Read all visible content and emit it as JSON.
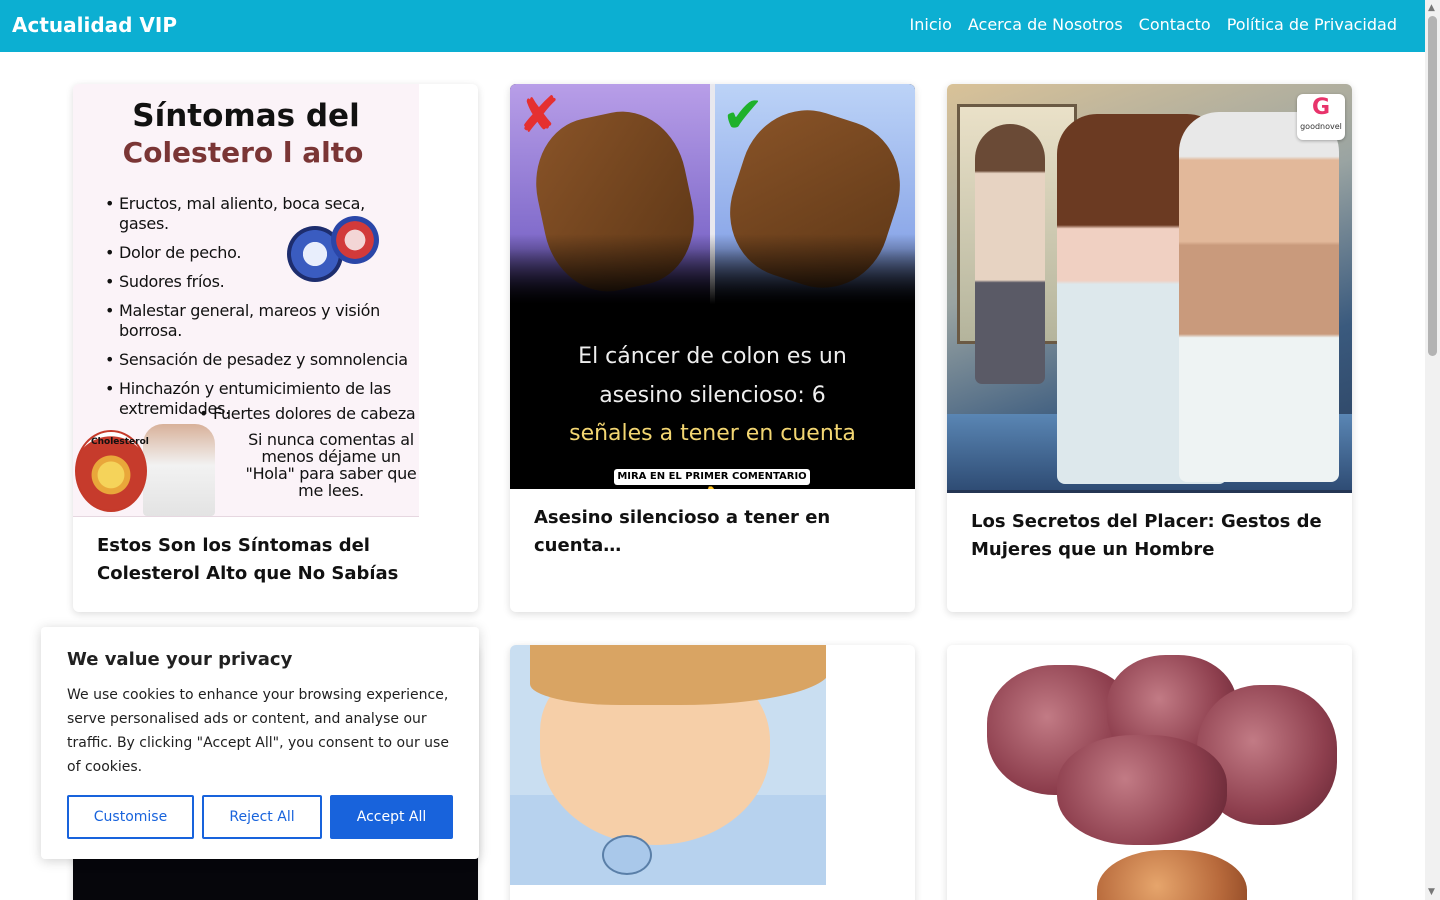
{
  "header": {
    "brand": "Actualidad VIP",
    "nav": [
      "Inicio",
      "Acerca de Nosotros",
      "Contacto",
      "Política de Privacidad"
    ]
  },
  "articles": [
    {
      "title": "Estos Son los Síntomas del Colesterol Alto que No Sabías",
      "image": {
        "heading1": "Síntomas del",
        "heading2": "Colestero l alto",
        "bullets": [
          "Eructos, mal aliento, boca seca, gases.",
          "Dolor de pecho.",
          "Sudores fríos.",
          "Malestar general, mareos y visión borrosa.",
          "Sensación de pesadez y somnolencia",
          "Hinchazón y entumicimiento de las extremidades."
        ],
        "last_bullet": "Fuertes dolores de cabeza",
        "note": "Si nunca comentas al menos déjame un \"Hola\" para saber que me lees.",
        "badge": "Cholesterol"
      }
    },
    {
      "title": "Asesino silencioso a tener en cuenta…",
      "image": {
        "line1": "El cáncer de colon es un",
        "line2": "asesino silencioso: 6",
        "line3": "señales a tener en cuenta",
        "tag": "MIRA EN EL PRIMER COMENTARIO👇"
      }
    },
    {
      "title": "Los Secretos del Placer: Gestos de Mujeres que un Hombre",
      "image": {
        "logo_text": "goodnovel"
      }
    }
  ],
  "cookie_banner": {
    "title": "We value your privacy",
    "text": "We use cookies to enhance your browsing experience, serve personalised ads or content, and analyse our traffic. By clicking \"Accept All\", you consent to our use of cookies.",
    "customise": "Customise",
    "reject": "Reject All",
    "accept": "Accept All"
  },
  "colors": {
    "header": "#0cafd2",
    "button_primary": "#1863dc"
  }
}
